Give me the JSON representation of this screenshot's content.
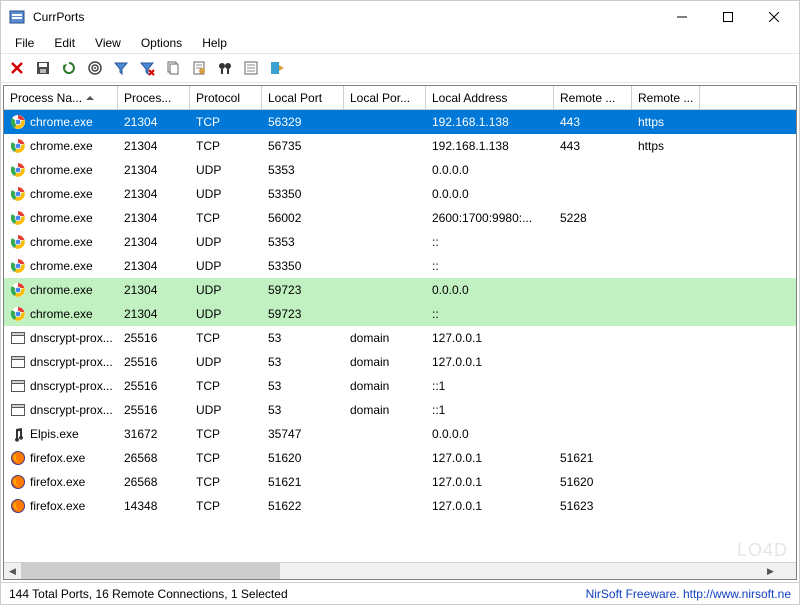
{
  "window": {
    "title": "CurrPorts",
    "controls": {
      "minimize": "min",
      "maximize": "max",
      "close": "close"
    }
  },
  "menu": {
    "items": [
      "File",
      "Edit",
      "View",
      "Options",
      "Help"
    ]
  },
  "toolbar": {
    "buttons": [
      {
        "name": "close-connection-icon",
        "glyph": "✕",
        "color": "#d40000"
      },
      {
        "name": "save-icon",
        "glyph": "💾",
        "svg": "save"
      },
      {
        "name": "refresh-icon",
        "glyph": "↻",
        "svg": "refresh"
      },
      {
        "name": "auto-refresh-icon",
        "glyph": "◉",
        "svg": "target"
      },
      {
        "name": "filter-icon",
        "glyph": "▽",
        "svg": "funnel"
      },
      {
        "name": "clear-filter-icon",
        "glyph": "▽",
        "svg": "funnel-x"
      },
      {
        "name": "copy-icon",
        "glyph": "📋",
        "svg": "copy"
      },
      {
        "name": "properties-icon",
        "glyph": "📄",
        "svg": "props"
      },
      {
        "name": "find-icon",
        "glyph": "🔍",
        "svg": "binoculars"
      },
      {
        "name": "html-report-icon",
        "glyph": "▦",
        "svg": "report"
      },
      {
        "name": "exit-icon",
        "glyph": "↪",
        "svg": "exit"
      }
    ]
  },
  "table": {
    "columns": [
      {
        "label": "Process Na...",
        "sorted": true
      },
      {
        "label": "Proces..."
      },
      {
        "label": "Protocol"
      },
      {
        "label": "Local Port"
      },
      {
        "label": "Local Por..."
      },
      {
        "label": "Local Address"
      },
      {
        "label": "Remote ..."
      },
      {
        "label": "Remote ..."
      }
    ],
    "rows": [
      {
        "icon": "chrome",
        "cells": [
          "chrome.exe",
          "21304",
          "TCP",
          "56329",
          "",
          "192.168.1.138",
          "443",
          "https"
        ],
        "selected": true
      },
      {
        "icon": "chrome",
        "cells": [
          "chrome.exe",
          "21304",
          "TCP",
          "56735",
          "",
          "192.168.1.138",
          "443",
          "https"
        ]
      },
      {
        "icon": "chrome",
        "cells": [
          "chrome.exe",
          "21304",
          "UDP",
          "5353",
          "",
          "0.0.0.0",
          "",
          ""
        ]
      },
      {
        "icon": "chrome",
        "cells": [
          "chrome.exe",
          "21304",
          "UDP",
          "53350",
          "",
          "0.0.0.0",
          "",
          ""
        ]
      },
      {
        "icon": "chrome",
        "cells": [
          "chrome.exe",
          "21304",
          "TCP",
          "56002",
          "",
          "2600:1700:9980:...",
          "5228",
          ""
        ]
      },
      {
        "icon": "chrome",
        "cells": [
          "chrome.exe",
          "21304",
          "UDP",
          "5353",
          "",
          "::",
          "",
          ""
        ]
      },
      {
        "icon": "chrome",
        "cells": [
          "chrome.exe",
          "21304",
          "UDP",
          "53350",
          "",
          "::",
          "",
          ""
        ]
      },
      {
        "icon": "chrome",
        "cells": [
          "chrome.exe",
          "21304",
          "UDP",
          "59723",
          "",
          "0.0.0.0",
          "",
          ""
        ],
        "highlight": true
      },
      {
        "icon": "chrome",
        "cells": [
          "chrome.exe",
          "21304",
          "UDP",
          "59723",
          "",
          "::",
          "",
          ""
        ],
        "highlight": true
      },
      {
        "icon": "window",
        "cells": [
          "dnscrypt-prox...",
          "25516",
          "TCP",
          "53",
          "domain",
          "127.0.0.1",
          "",
          ""
        ]
      },
      {
        "icon": "window",
        "cells": [
          "dnscrypt-prox...",
          "25516",
          "UDP",
          "53",
          "domain",
          "127.0.0.1",
          "",
          ""
        ]
      },
      {
        "icon": "window",
        "cells": [
          "dnscrypt-prox...",
          "25516",
          "TCP",
          "53",
          "domain",
          "::1",
          "",
          ""
        ]
      },
      {
        "icon": "window",
        "cells": [
          "dnscrypt-prox...",
          "25516",
          "UDP",
          "53",
          "domain",
          "::1",
          "",
          ""
        ]
      },
      {
        "icon": "music",
        "cells": [
          "Elpis.exe",
          "31672",
          "TCP",
          "35747",
          "",
          "0.0.0.0",
          "",
          ""
        ]
      },
      {
        "icon": "firefox",
        "cells": [
          "firefox.exe",
          "26568",
          "TCP",
          "51620",
          "",
          "127.0.0.1",
          "51621",
          ""
        ]
      },
      {
        "icon": "firefox",
        "cells": [
          "firefox.exe",
          "26568",
          "TCP",
          "51621",
          "",
          "127.0.0.1",
          "51620",
          ""
        ]
      },
      {
        "icon": "firefox",
        "cells": [
          "firefox.exe",
          "14348",
          "TCP",
          "51622",
          "",
          "127.0.0.1",
          "51623",
          ""
        ]
      }
    ]
  },
  "statusbar": {
    "left": "144 Total Ports, 16 Remote Connections, 1 Selected",
    "right": "NirSoft Freeware.   http://www.nirsoft.ne"
  },
  "watermark": "LO4D"
}
